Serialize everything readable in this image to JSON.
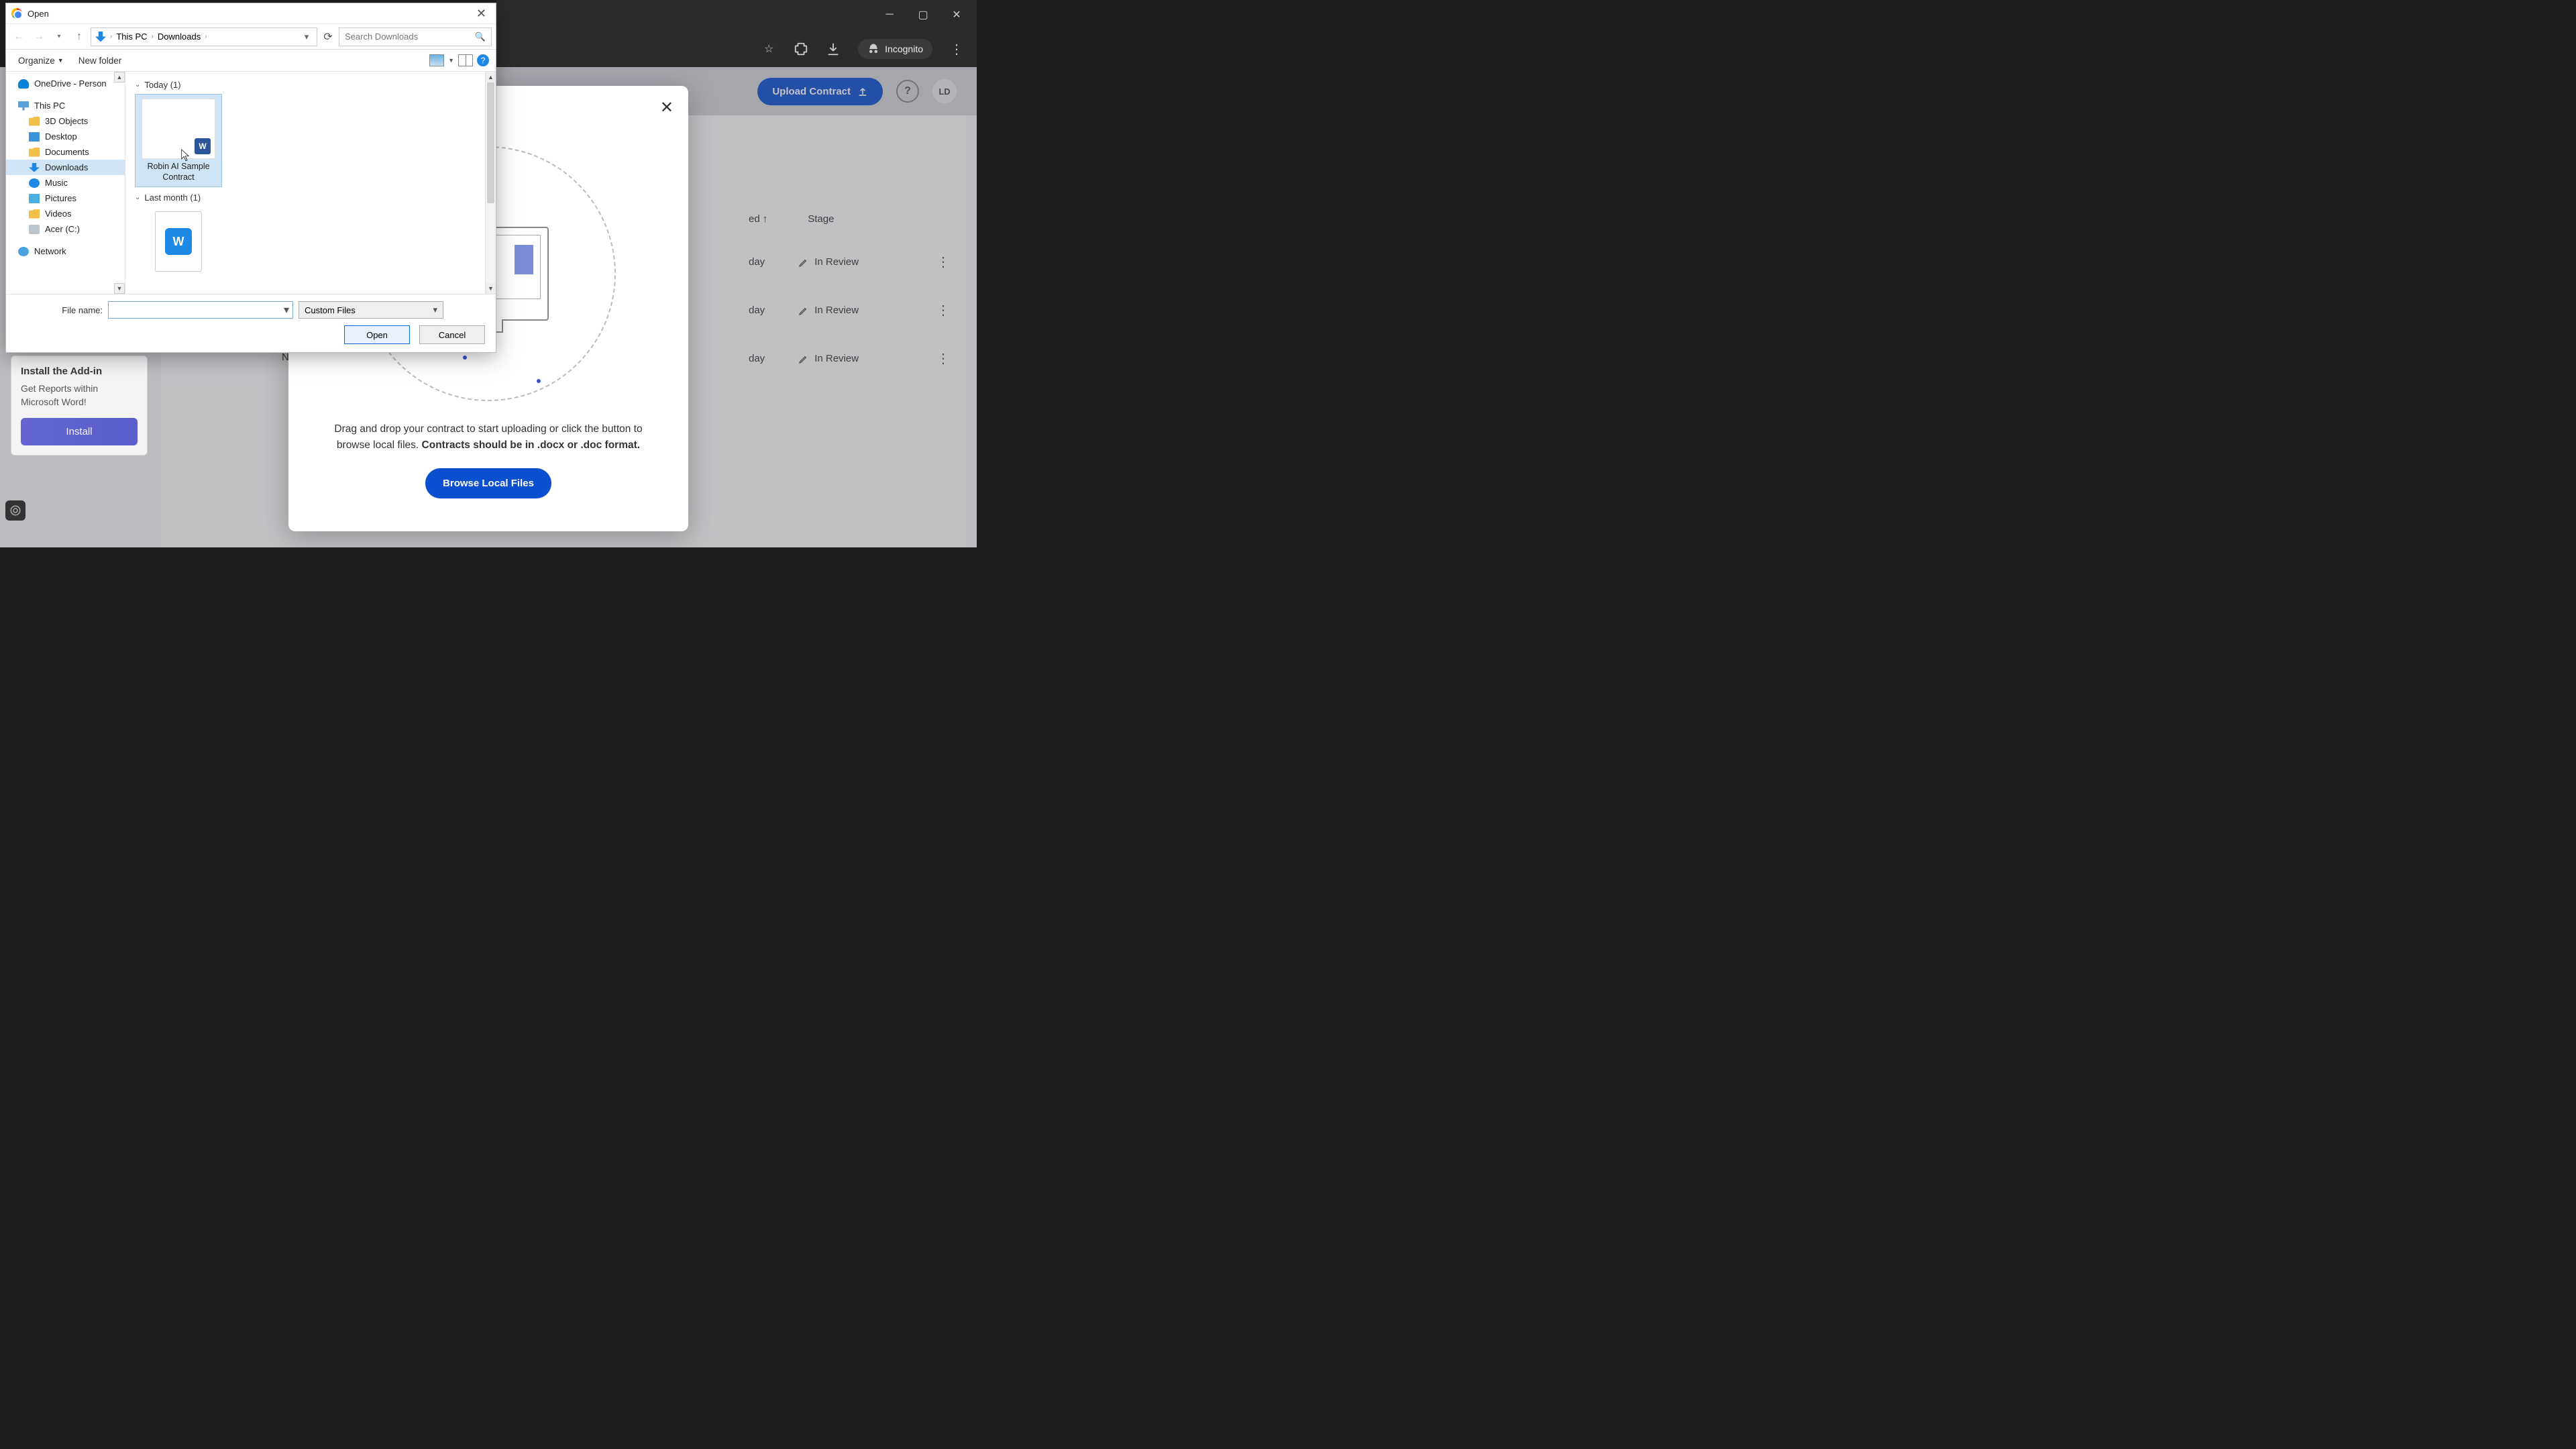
{
  "browser": {
    "incognito_label": "Incognito"
  },
  "app": {
    "upload_button": "Upload Contract",
    "avatar": "LD",
    "table": {
      "col_sorted": "ed",
      "col_stage": "Stage",
      "rows": [
        {
          "when": "day",
          "stage": "In Review"
        },
        {
          "when": "day",
          "stage": "In Review"
        },
        {
          "when": "day",
          "stage": "In Review"
        }
      ]
    },
    "addin": {
      "title": "Install the Add-in",
      "desc": "Get Reports within Microsoft Word!",
      "button": "Install"
    },
    "table_letter": "N"
  },
  "modal": {
    "text_plain": "Drag and drop your contract to start uploading or click the button to browse local files. ",
    "text_bold": "Contracts should be in .docx or .doc format.",
    "browse": "Browse Local Files"
  },
  "dialog": {
    "title": "Open",
    "breadcrumb": {
      "pc": "This PC",
      "downloads": "Downloads"
    },
    "search_placeholder": "Search Downloads",
    "toolbar": {
      "organize": "Organize",
      "new_folder": "New folder"
    },
    "tree": {
      "onedrive": "OneDrive - Person",
      "this_pc": "This PC",
      "objects3d": "3D Objects",
      "desktop": "Desktop",
      "documents": "Documents",
      "downloads": "Downloads",
      "music": "Music",
      "pictures": "Pictures",
      "videos": "Videos",
      "acer": "Acer (C:)",
      "network": "Network"
    },
    "groups": {
      "today": "Today (1)",
      "last_month": "Last month (1)"
    },
    "files": {
      "sample": "Robin AI Sample Contract"
    },
    "footer": {
      "filename_label": "File name:",
      "type": "Custom Files",
      "open": "Open",
      "cancel": "Cancel"
    }
  }
}
